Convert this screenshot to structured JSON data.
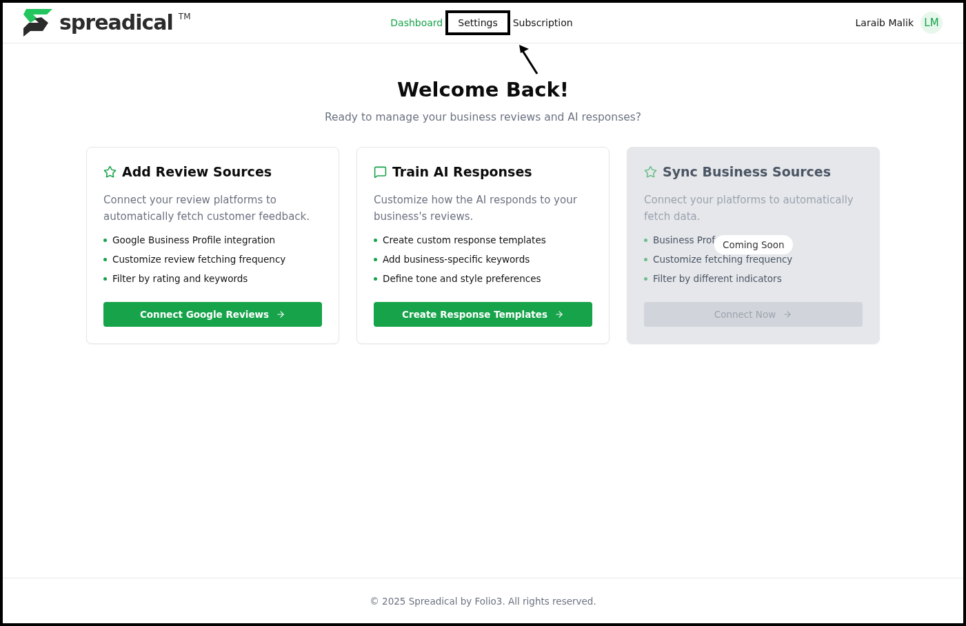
{
  "header": {
    "brand": "spreadical",
    "trademark": "TM",
    "nav": [
      {
        "label": "Dashboard",
        "selected": true,
        "highlighted": false
      },
      {
        "label": "Settings",
        "selected": false,
        "highlighted": true
      },
      {
        "label": "Subscription",
        "selected": false,
        "highlighted": false
      }
    ],
    "user": {
      "name": "Laraib Malik",
      "initials": "LM"
    }
  },
  "hero": {
    "title": "Welcome Back!",
    "subtitle": "Ready to manage your business reviews and AI responses?"
  },
  "cards": [
    {
      "title": "Add Review Sources",
      "description": "Connect your review platforms to automatically fetch customer feedback.",
      "features": [
        "Google Business Profile integration",
        "Customize review fetching frequency",
        "Filter by rating and keywords"
      ],
      "button": "Connect Google Reviews",
      "disabled": false
    },
    {
      "title": "Train AI Responses",
      "description": "Customize how the AI responds to your business's reviews.",
      "features": [
        "Create custom response templates",
        "Add business-specific keywords",
        "Define tone and style preferences"
      ],
      "button": "Create Response Templates",
      "disabled": false
    },
    {
      "title": "Sync Business Sources",
      "description": "Connect your platforms to automatically fetch data.",
      "features": [
        "Business Prof",
        "Customize fetching frequency",
        "Filter by different indicators"
      ],
      "button": "Connect Now",
      "disabled": true,
      "badge": "Coming Soon"
    }
  ],
  "footer": {
    "text": "© 2025 Spreadical by Folio3. All rights reserved."
  }
}
